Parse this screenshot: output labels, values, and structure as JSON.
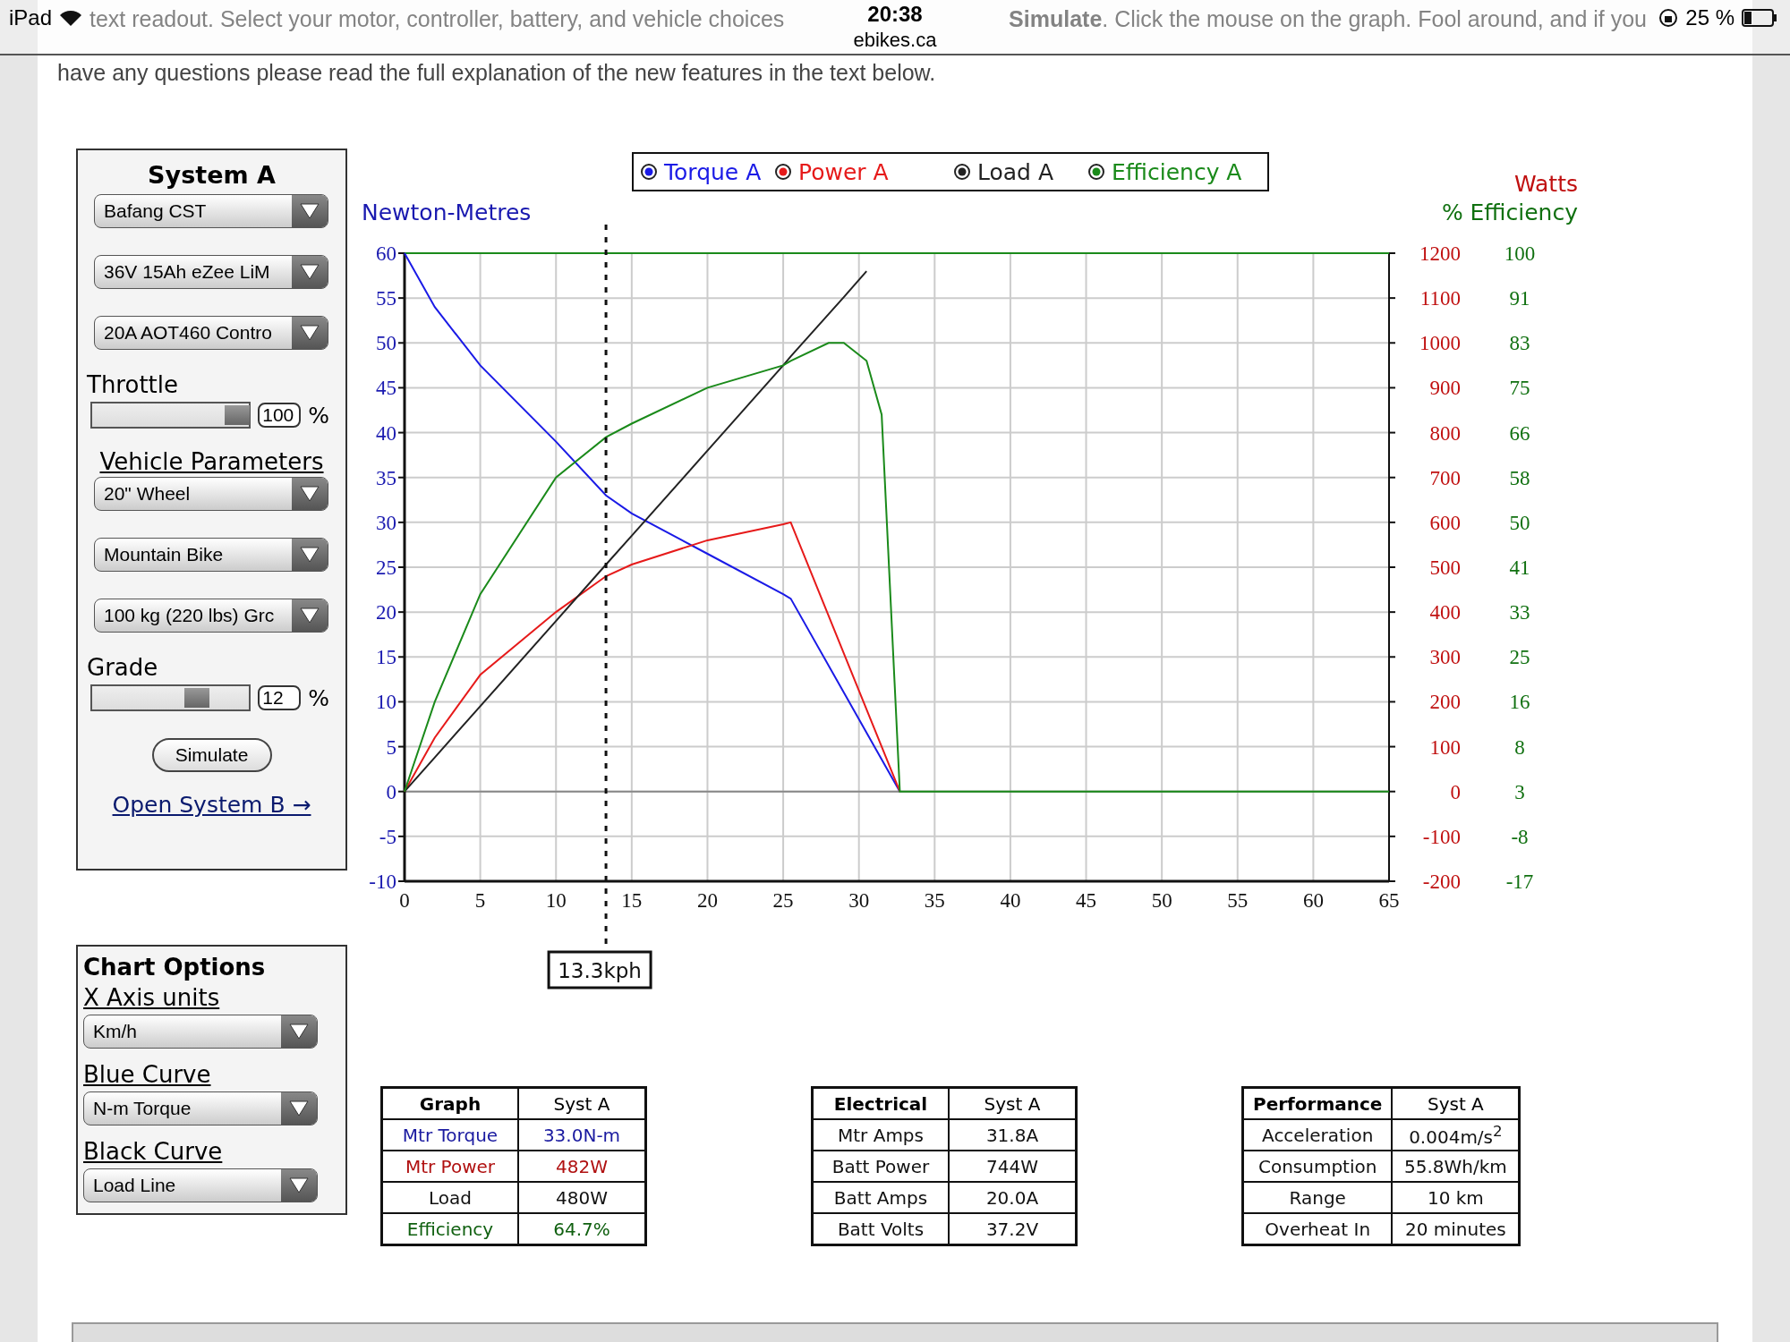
{
  "status_bar": {
    "device": "iPad",
    "time": "20:38",
    "url": "ebikes.ca",
    "battery": "25 %"
  },
  "intro": [
    "text readout. Select your motor, controller, battery, and vehicle choices",
    "**Simulate**. Click the mouse on the graph. Fool around, and if you",
    "have any questions please read the full explanation of the new features in the text below."
  ],
  "system_panel": {
    "title": "System A",
    "motor_selects": [
      {
        "value": "Bafang CST"
      },
      {
        "value": "36V 15Ah eZee LiM"
      },
      {
        "value": "20A AOT460 Contro"
      }
    ],
    "throttle": {
      "label": "Throttle",
      "level": 1.0,
      "value": "100",
      "unit": "%"
    },
    "vehicle_heading": "Vehicle Parameters",
    "vehicle_selects": [
      {
        "value": "20\"  Wheel"
      },
      {
        "value": "Mountain Bike"
      },
      {
        "value": "100 kg (220 lbs) Grc"
      }
    ],
    "grade": {
      "label": "Grade",
      "level": 0.69,
      "value": "12",
      "unit": "%"
    },
    "simulate_button": "Simulate",
    "open_link": "Open System B →"
  },
  "chart_options": {
    "title": "Chart Options",
    "groups": [
      {
        "label": "X Axis units",
        "value": "Km/h"
      },
      {
        "label": "Blue Curve",
        "value": "N-m Torque"
      },
      {
        "label": "Black Curve",
        "value": "Load Line"
      }
    ]
  },
  "chart": {
    "left_axis_title": "Newton-Metres",
    "watts_title": "Watts",
    "efficiency_title": "% Efficiency",
    "watts_labels": [
      "1200",
      "1100",
      "1000",
      "900",
      "800",
      "700",
      "600",
      "500",
      "400",
      "300",
      "200",
      "100",
      "0",
      "-100",
      "-200"
    ],
    "efficiency_labels": [
      "100",
      "91",
      "83",
      "75",
      "66",
      "58",
      "50",
      "41",
      "33",
      "25",
      "16",
      "8",
      "3",
      "-8",
      "-17"
    ],
    "chart_data": {
      "type": "line",
      "x": [
        0,
        2,
        5,
        10,
        13.3,
        15,
        20,
        25,
        25.5,
        28,
        29,
        30.5,
        31.5,
        32.7,
        35,
        40,
        45,
        50,
        55,
        60,
        65
      ],
      "series": [
        {
          "name": "Torque A",
          "color": "#1a1ae6",
          "values": [
            60,
            54,
            47.5,
            39,
            33,
            31,
            26.5,
            22,
            21.5,
            null,
            null,
            null,
            null,
            0,
            null,
            null,
            null,
            null,
            null,
            null,
            null
          ]
        },
        {
          "name": "Power A",
          "color": "#e61a1a",
          "values": [
            0,
            6,
            13,
            20,
            24,
            25.3,
            28,
            29.8,
            30,
            null,
            null,
            null,
            null,
            0,
            null,
            null,
            null,
            null,
            null,
            null,
            null
          ]
        },
        {
          "name": "Load A",
          "color": "#222222",
          "values": [
            0,
            3.8,
            9.5,
            19,
            25.3,
            28.5,
            38,
            47.5,
            48.5,
            53.2,
            55.1,
            58,
            null,
            null,
            null,
            null,
            null,
            null,
            null,
            null,
            null
          ]
        },
        {
          "name": "Efficiency A",
          "color": "#1a8a1a",
          "values": [
            0,
            10,
            22,
            35,
            39.5,
            41,
            45,
            47.5,
            48,
            50,
            50,
            48,
            42,
            0,
            0,
            0,
            0,
            0,
            0,
            0,
            0
          ]
        }
      ],
      "xlim": [
        0,
        65
      ],
      "ylim": [
        -10,
        60
      ],
      "xticks": [
        0,
        5,
        10,
        15,
        20,
        25,
        30,
        35,
        40,
        45,
        50,
        55,
        60,
        65
      ],
      "yticks": [
        60,
        55,
        50,
        45,
        40,
        35,
        30,
        25,
        20,
        15,
        10,
        5,
        0,
        -5,
        -10
      ],
      "grid": true,
      "legend": true,
      "ref_lines": [
        {
          "axis": "x",
          "value": 13.3,
          "label": "13.3kph"
        }
      ]
    }
  },
  "tables": [
    {
      "columns": [
        "Graph",
        "Syst A"
      ],
      "rows": [
        {
          "label": "Mtr Torque",
          "value": "33.0N-m",
          "color": "#1a1aa0"
        },
        {
          "label": "Mtr Power",
          "value": "482W",
          "color": "#b01010"
        },
        {
          "label": "Load",
          "value": "480W",
          "color": "#111111"
        },
        {
          "label": "Efficiency",
          "value": "64.7%",
          "color": "#106010"
        }
      ]
    },
    {
      "columns": [
        "Electrical",
        "Syst A"
      ],
      "rows": [
        {
          "label": "Mtr Amps",
          "value": "31.8A"
        },
        {
          "label": "Batt Power",
          "value": "744W"
        },
        {
          "label": "Batt Amps",
          "value": "20.0A"
        },
        {
          "label": "Batt Volts",
          "value": "37.2V"
        }
      ]
    },
    {
      "columns": [
        "Performance",
        "Syst A"
      ],
      "rows": [
        {
          "label": "Acceleration",
          "value": "0.004m/s$^{2}$"
        },
        {
          "label": "Consumption",
          "value": "55.8Wh/km"
        },
        {
          "label": "Range",
          "value": "10 km"
        },
        {
          "label": "Overheat In",
          "value": "20 minutes"
        }
      ]
    }
  ]
}
